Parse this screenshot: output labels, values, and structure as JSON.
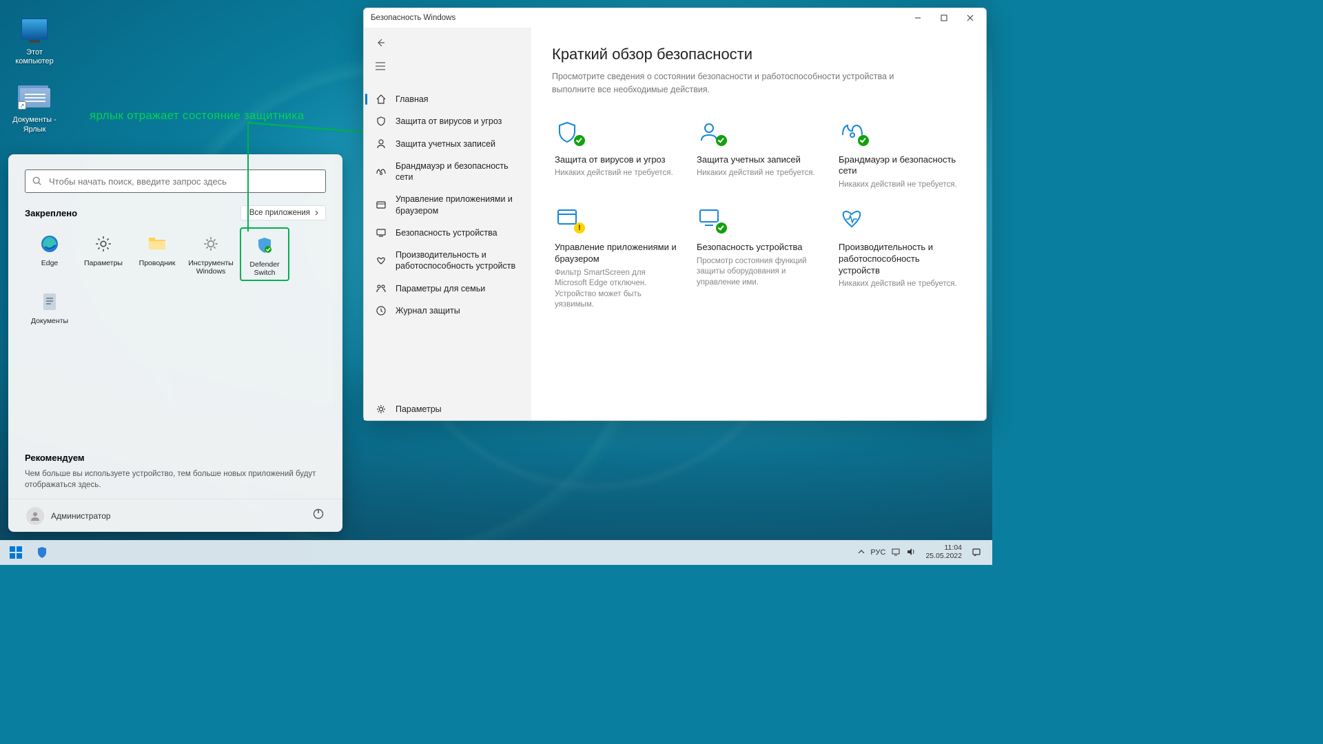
{
  "desktop": {
    "icons": {
      "this_pc": "Этот компьютер",
      "documents_shortcut": "Документы - Ярлык"
    }
  },
  "annotation": "ярлык отражает состояние защитника",
  "start_menu": {
    "search_placeholder": "Чтобы начать поиск, введите запрос здесь",
    "pinned_title": "Закреплено",
    "all_apps_label": "Все приложения",
    "items": [
      {
        "label": "Edge"
      },
      {
        "label": "Параметры"
      },
      {
        "label": "Проводник"
      },
      {
        "label": "Инструменты Windows"
      },
      {
        "label": "Defender Switch"
      },
      {
        "label": "Документы"
      }
    ],
    "recommended_title": "Рекомендуем",
    "recommended_text": "Чем больше вы используете устройство, тем больше новых приложений будут отображаться здесь.",
    "user": "Администратор"
  },
  "security_window": {
    "title": "Безопасность Windows",
    "nav": {
      "items": [
        "Главная",
        "Защита от вирусов и угроз",
        "Защита учетных записей",
        "Брандмауэр и безопасность сети",
        "Управление приложениями и браузером",
        "Безопасность устройства",
        "Производительность и работоспособность устройств",
        "Параметры для семьи",
        "Журнал защиты"
      ],
      "settings": "Параметры"
    },
    "heading": "Краткий обзор безопасности",
    "subheading": "Просмотрите сведения о состоянии безопасности и работоспособности устройства и выполните все необходимые действия.",
    "cards": [
      {
        "title": "Защита от вирусов и угроз",
        "sub": "Никаких действий не требуется.",
        "status": "ok",
        "icon": "shield"
      },
      {
        "title": "Защита учетных записей",
        "sub": "Никаких действий не требуется.",
        "status": "ok",
        "icon": "account"
      },
      {
        "title": "Брандмауэр и безопасность сети",
        "sub": "Никаких действий не требуется.",
        "status": "ok",
        "icon": "firewall"
      },
      {
        "title": "Управление приложениями и браузером",
        "sub": "Фильтр SmartScreen для Microsoft Edge отключен. Устройство может быть уязвимым.",
        "status": "warn",
        "icon": "appbrowser"
      },
      {
        "title": "Безопасность устройства",
        "sub": "Просмотр состояния функций защиты оборудования и управление ими.",
        "status": "ok",
        "icon": "device"
      },
      {
        "title": "Производительность и работоспособность устройств",
        "sub": "Никаких действий не требуется.",
        "status": "none",
        "icon": "health"
      }
    ]
  },
  "taskbar": {
    "lang": "РУС",
    "time": "11:04",
    "date": "25.05.2022"
  }
}
